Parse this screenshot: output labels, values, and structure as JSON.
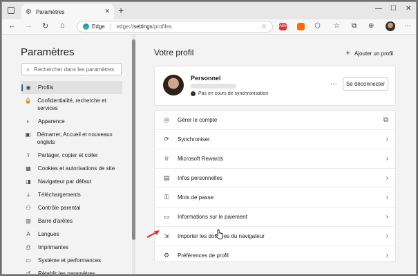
{
  "browser": {
    "tab_title": "Paramètres",
    "tab_close": "✕",
    "new_tab": "+",
    "address": {
      "brand": "Edge",
      "url_prefix": "edge://",
      "url_path": "settings",
      "url_rest": "/profiles"
    },
    "window_controls": [
      "—",
      "☐",
      "✕"
    ],
    "extensions": [
      {
        "label": "ABP",
        "color": "#e0332c"
      },
      {
        "label": "",
        "color": "#ff6a00"
      }
    ]
  },
  "sidebar": {
    "title": "Paramètres",
    "search_placeholder": "Rechercher dans les paramètres",
    "items": [
      {
        "label": "Profils",
        "icon": "profile-icon",
        "glyph": "◉",
        "active": true
      },
      {
        "label": "Confidentialité, recherche et services",
        "icon": "lock-icon",
        "glyph": "🔒",
        "active": false
      },
      {
        "label": "Apparence",
        "icon": "palette-icon",
        "glyph": "◐",
        "active": false
      },
      {
        "label": "Démarrer, Accueil et nouveaux onglets",
        "icon": "power-icon",
        "glyph": "▣",
        "active": false
      },
      {
        "label": "Partager, copier et coller",
        "icon": "share-icon",
        "glyph": "⇪",
        "active": false
      },
      {
        "label": "Cookies et autorisations de site",
        "icon": "cookie-icon",
        "glyph": "▦",
        "active": false
      },
      {
        "label": "Navigateur par défaut",
        "icon": "browser-icon",
        "glyph": "◨",
        "active": false
      },
      {
        "label": "Téléchargements",
        "icon": "download-icon",
        "glyph": "⤓",
        "active": false
      },
      {
        "label": "Contrôle parental",
        "icon": "family-icon",
        "glyph": "⚇",
        "active": false
      },
      {
        "label": "Barre d'arêtes",
        "icon": "edge-bar-icon",
        "glyph": "▥",
        "active": false
      },
      {
        "label": "Langues",
        "icon": "language-icon",
        "glyph": "A",
        "active": false
      },
      {
        "label": "Imprimantes",
        "icon": "printer-icon",
        "glyph": "⎙",
        "active": false
      },
      {
        "label": "Système et performances",
        "icon": "system-icon",
        "glyph": "▭",
        "active": false
      },
      {
        "label": "Rétablir les paramètres",
        "icon": "reset-icon",
        "glyph": "↺",
        "active": false
      }
    ]
  },
  "main": {
    "title": "Votre profil",
    "add_profile": "Ajouter un profil",
    "profile": {
      "name": "Personnel",
      "sync_status": "Pas en cours de synchronisation",
      "more": "···",
      "logout": "Se déconnecter"
    },
    "rows": [
      {
        "label": "Gérer le compte",
        "icon": "account-icon",
        "glyph": "◎",
        "end": "⧉"
      },
      {
        "label": "Synchroniser",
        "icon": "sync-icon",
        "glyph": "⟳",
        "end": "›"
      },
      {
        "label": "Microsoft Rewards",
        "icon": "rewards-icon",
        "glyph": "♕",
        "end": "›"
      },
      {
        "label": "Infos personnelles",
        "icon": "personal-info-icon",
        "glyph": "▤",
        "end": "›"
      },
      {
        "label": "Mots de passe",
        "icon": "key-icon",
        "glyph": "⚿",
        "end": "›"
      },
      {
        "label": "Informations sur le paiement",
        "icon": "card-icon",
        "glyph": "▭",
        "end": "›"
      },
      {
        "label": "Importer les données du navigateur",
        "icon": "import-icon",
        "glyph": "⇲",
        "end": "›"
      },
      {
        "label": "Préférences de profil",
        "icon": "profile-prefs-icon",
        "glyph": "⚙",
        "end": "›"
      }
    ]
  },
  "colors": {
    "accent": "#0f6cbd",
    "annotation_arrow": "#e2383f"
  }
}
